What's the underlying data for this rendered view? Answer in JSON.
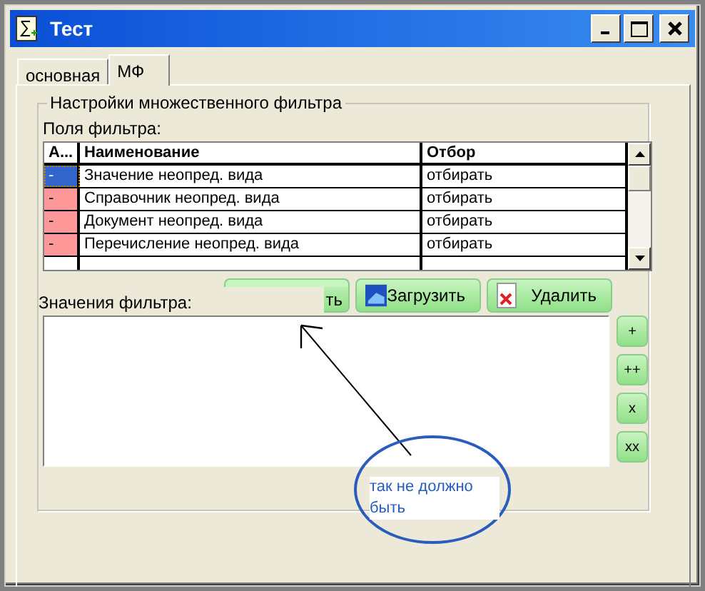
{
  "window": {
    "title": "Тест"
  },
  "tabs": [
    {
      "label": "основная",
      "selected": false
    },
    {
      "label": "МФ",
      "selected": true
    }
  ],
  "group": {
    "title": "Настройки множественного фильтра",
    "fields_label": "Поля фильтра:",
    "table": {
      "columns": [
        "А...",
        "Наименование",
        "Отбор"
      ],
      "rows": [
        {
          "flag": "-",
          "name": "Значение неопред. вида",
          "filter": "отбирать",
          "selected": true
        },
        {
          "flag": "-",
          "name": "Справочник неопред. вида",
          "filter": "отбирать",
          "selected": false
        },
        {
          "flag": "-",
          "name": "Документ неопред. вида",
          "filter": "отбирать",
          "selected": false
        },
        {
          "flag": "-",
          "name": "Перечисление неопред. вида",
          "filter": "отбирать",
          "selected": false
        }
      ]
    },
    "buttons": [
      {
        "label": "ть",
        "kind": "save"
      },
      {
        "label": "Загрузить",
        "kind": "load"
      },
      {
        "label": "Удалить",
        "kind": "delete"
      }
    ],
    "values_label": "Значения фильтра:",
    "side_buttons": [
      "+",
      "++",
      "x",
      "xx"
    ]
  },
  "annotation": {
    "text": "так не должно быть"
  }
}
